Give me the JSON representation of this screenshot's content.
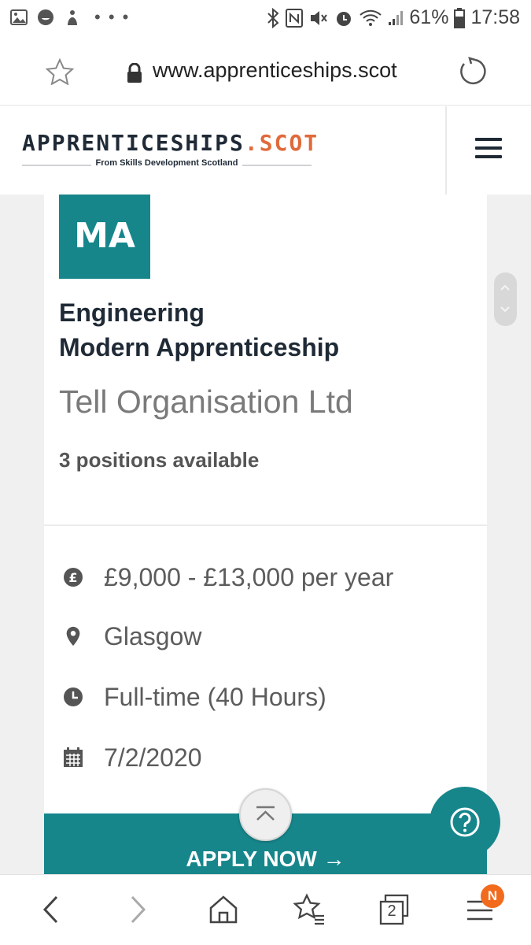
{
  "status_bar": {
    "battery": "61%",
    "time": "17:58"
  },
  "browser": {
    "url": "www.apprenticeships.scot",
    "tab_count": "2",
    "menu_badge": "N"
  },
  "site": {
    "logo_main": "APPRENTICESHIPS",
    "logo_dot": ".SCOT",
    "logo_sub": "From Skills Development Scotland"
  },
  "job": {
    "badge": "MA",
    "title_line1": "Engineering",
    "title_line2": "Modern Apprenticeship",
    "company": "Tell Organisation Ltd",
    "positions": "3 positions available",
    "salary": "£9,000 - £13,000 per year",
    "location": "Glasgow",
    "hours": "Full-time (40 Hours)",
    "date": "7/2/2020",
    "apply_label": "APPLY NOW →"
  },
  "colors": {
    "teal": "#16868b",
    "orange": "#e06a3b",
    "navy": "#1f2a36"
  },
  "icons": [
    "image-icon",
    "smiley-icon",
    "sailor-icon",
    "bluetooth-icon",
    "nfc-icon",
    "mute-icon",
    "alarm-icon",
    "wifi-icon",
    "signal-icon",
    "battery-icon",
    "star-icon",
    "lock-icon",
    "reload-icon",
    "menu-icon",
    "pound-icon",
    "location-pin-icon",
    "clock-icon",
    "calendar-icon",
    "arrow-up-icon",
    "question-icon",
    "back-icon",
    "forward-icon",
    "home-icon",
    "bookmarks-icon",
    "tabs-icon",
    "browser-menu-icon"
  ]
}
